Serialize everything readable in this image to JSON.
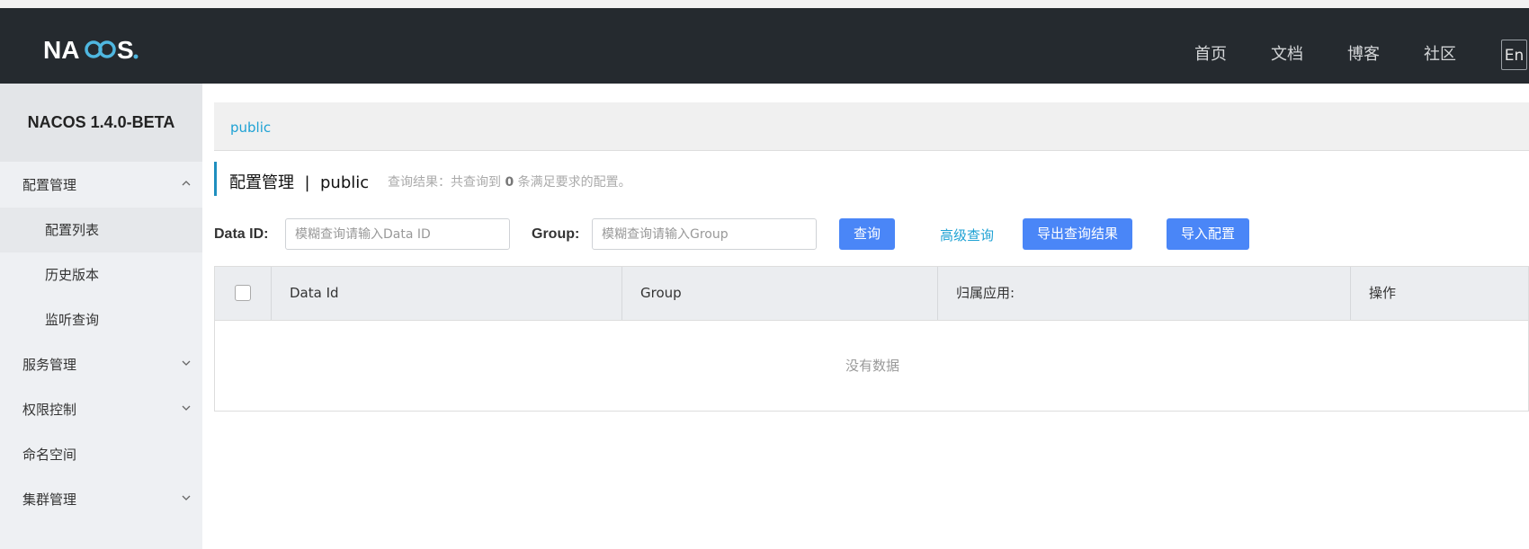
{
  "header": {
    "logo_text": "NACOS.",
    "nav": [
      {
        "label": "首页"
      },
      {
        "label": "文档"
      },
      {
        "label": "博客"
      },
      {
        "label": "社区"
      }
    ],
    "lang": "En"
  },
  "sidebar": {
    "version": "NACOS 1.4.0-BETA",
    "items": [
      {
        "label": "配置管理",
        "icon": "chevron-up-icon"
      },
      {
        "label": "配置列表"
      },
      {
        "label": "历史版本"
      },
      {
        "label": "监听查询"
      },
      {
        "label": "服务管理",
        "icon": "chevron-down-icon"
      },
      {
        "label": "权限控制",
        "icon": "chevron-down-icon"
      },
      {
        "label": "命名空间"
      },
      {
        "label": "集群管理",
        "icon": "chevron-down-icon"
      }
    ]
  },
  "breadcrumb": {
    "namespace": "public"
  },
  "page": {
    "title": "配置管理",
    "separator": "|",
    "namespace": "public",
    "result_prefix": "查询结果：共查询到",
    "result_count": "0",
    "result_suffix": "条满足要求的配置。"
  },
  "filters": {
    "dataid_label": "Data ID:",
    "dataid_placeholder": "模糊查询请输入Data ID",
    "group_label": "Group:",
    "group_placeholder": "模糊查询请输入Group",
    "search_button": "查询",
    "advanced_link": "高级查询",
    "export_button": "导出查询结果",
    "import_button": "导入配置"
  },
  "table": {
    "columns": [
      "Data Id",
      "Group",
      "归属应用:",
      "操作"
    ],
    "empty_text": "没有数据"
  },
  "colors": {
    "header_bg": "#252a2f",
    "accent_blue": "#4a86f7",
    "link_cyan": "#1fa2d4"
  }
}
